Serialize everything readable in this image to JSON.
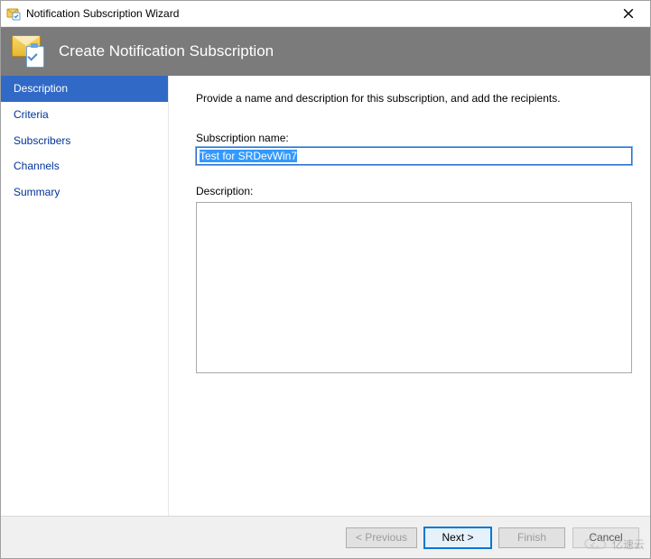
{
  "titlebar": {
    "title": "Notification Subscription Wizard",
    "close_icon": "close-icon"
  },
  "header": {
    "title": "Create Notification Subscription"
  },
  "sidebar": {
    "steps": [
      {
        "id": "description",
        "label": "Description",
        "active": true
      },
      {
        "id": "criteria",
        "label": "Criteria",
        "active": false
      },
      {
        "id": "subscribers",
        "label": "Subscribers",
        "active": false
      },
      {
        "id": "channels",
        "label": "Channels",
        "active": false
      },
      {
        "id": "summary",
        "label": "Summary",
        "active": false
      }
    ]
  },
  "content": {
    "instruction": "Provide a name and description for this subscription, and add the recipients.",
    "name_label": "Subscription name:",
    "name_value": "Test for SRDevWin7",
    "description_label": "Description:",
    "description_value": ""
  },
  "footer": {
    "previous": "< Previous",
    "next": "Next >",
    "finish": "Finish",
    "cancel": "Cancel"
  },
  "watermark": {
    "text": "亿速云"
  }
}
